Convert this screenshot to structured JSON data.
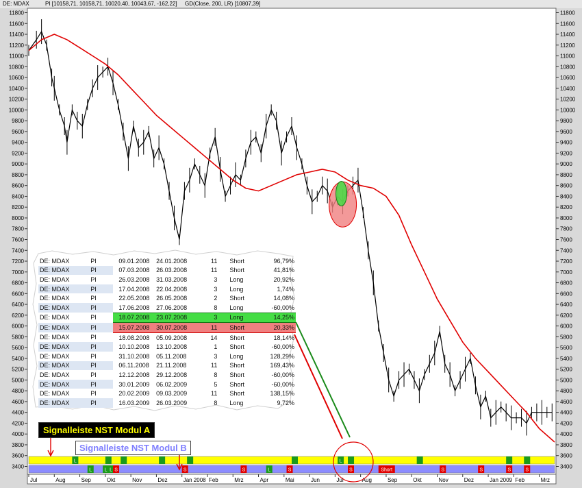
{
  "header": {
    "instrument": "DE: MDAX",
    "legend_pi": "PI [10158,71, 10158,71, 10020,40, 10043,67, -162,22]",
    "legend_gd": "GD(Close, 200, LR) [10807,39]"
  },
  "labels": {
    "signal_a": "Signalleiste NST Modul A",
    "signal_b": "Signalleiste NST Modul B"
  },
  "colors": {
    "price": "#000000",
    "moving_average": "#e00000",
    "strip_a": "#ffff00",
    "strip_b": "#8c8cff",
    "long_marker": "#1a9a1a",
    "short_marker": "#e00000",
    "highlight_long": "#44dd44",
    "highlight_short": "#f08080"
  },
  "trades": [
    {
      "symbol": "DE: MDAX",
      "type": "PI",
      "entry": "09.01.2008",
      "exit": "24.01.2008",
      "days": "11",
      "side": "Short",
      "result": "96,79%"
    },
    {
      "symbol": "DE: MDAX",
      "type": "PI",
      "entry": "07.03.2008",
      "exit": "26.03.2008",
      "days": "11",
      "side": "Short",
      "result": "41,81%"
    },
    {
      "symbol": "DE: MDAX",
      "type": "PI",
      "entry": "26.03.2008",
      "exit": "31.03.2008",
      "days": "3",
      "side": "Long",
      "result": "20,92%"
    },
    {
      "symbol": "DE: MDAX",
      "type": "PI",
      "entry": "17.04.2008",
      "exit": "22.04.2008",
      "days": "3",
      "side": "Long",
      "result": "1,74%"
    },
    {
      "symbol": "DE: MDAX",
      "type": "PI",
      "entry": "22.05.2008",
      "exit": "26.05.2008",
      "days": "2",
      "side": "Short",
      "result": "14,08%"
    },
    {
      "symbol": "DE: MDAX",
      "type": "PI",
      "entry": "17.06.2008",
      "exit": "27.06.2008",
      "days": "8",
      "side": "Long",
      "result": "-60,00%"
    },
    {
      "symbol": "DE: MDAX",
      "type": "PI",
      "entry": "18.07.2008",
      "exit": "23.07.2008",
      "days": "3",
      "side": "Long",
      "result": "14,25%",
      "highlight": "long"
    },
    {
      "symbol": "DE: MDAX",
      "type": "PI",
      "entry": "15.07.2008",
      "exit": "30.07.2008",
      "days": "11",
      "side": "Short",
      "result": "20,33%",
      "highlight": "short"
    },
    {
      "symbol": "DE: MDAX",
      "type": "PI",
      "entry": "18.08.2008",
      "exit": "05.09.2008",
      "days": "14",
      "side": "Short",
      "result": "18,14%"
    },
    {
      "symbol": "DE: MDAX",
      "type": "PI",
      "entry": "10.10.2008",
      "exit": "13.10.2008",
      "days": "1",
      "side": "Short",
      "result": "-60,00%"
    },
    {
      "symbol": "DE: MDAX",
      "type": "PI",
      "entry": "31.10.2008",
      "exit": "05.11.2008",
      "days": "3",
      "side": "Long",
      "result": "128,29%"
    },
    {
      "symbol": "DE: MDAX",
      "type": "PI",
      "entry": "06.11.2008",
      "exit": "21.11.2008",
      "days": "11",
      "side": "Short",
      "result": "169,43%"
    },
    {
      "symbol": "DE: MDAX",
      "type": "PI",
      "entry": "12.12.2008",
      "exit": "29.12.2008",
      "days": "8",
      "side": "Short",
      "result": "-60,00%"
    },
    {
      "symbol": "DE: MDAX",
      "type": "PI",
      "entry": "30.01.2009",
      "exit": "06.02.2009",
      "days": "5",
      "side": "Short",
      "result": "-60,00%"
    },
    {
      "symbol": "DE: MDAX",
      "type": "PI",
      "entry": "20.02.2009",
      "exit": "09.03.2009",
      "days": "11",
      "side": "Short",
      "result": "138,15%"
    },
    {
      "symbol": "DE: MDAX",
      "type": "PI",
      "entry": "16.03.2009",
      "exit": "26.03.2009",
      "days": "8",
      "side": "Long",
      "result": "9,72%"
    }
  ],
  "chart_data": {
    "type": "line",
    "ylim": [
      3300,
      11900
    ],
    "yticks": [
      3400,
      3600,
      3800,
      4000,
      4200,
      4400,
      4600,
      4800,
      5000,
      5200,
      5400,
      5600,
      5800,
      6000,
      6200,
      6400,
      6600,
      6800,
      7000,
      7200,
      7400,
      7600,
      7800,
      8000,
      8200,
      8400,
      8600,
      8800,
      9000,
      9200,
      9400,
      9600,
      9800,
      10000,
      10200,
      10400,
      10600,
      10800,
      11000,
      11200,
      11400,
      11600,
      11800
    ],
    "ytick_labels": [
      "3400",
      "3600",
      "3800",
      "4000",
      "4200",
      "4400",
      "4600",
      "4800",
      "5000",
      "5200",
      "5400",
      "5600",
      "5800",
      "6000",
      "6200",
      "6400",
      "6600",
      "6800",
      "7000",
      "7200",
      "7400",
      "7600",
      "7800",
      "8000",
      "8200",
      "8400",
      "8600",
      "8800",
      "9000",
      "9200",
      "9400",
      "9600",
      "9800",
      "10000",
      "10200",
      "10400",
      "10600",
      "10800",
      "11000",
      "11200",
      "11400",
      "11600",
      "11800"
    ],
    "xlim": [
      0,
      20.6
    ],
    "xticks": [
      0,
      1,
      2,
      3,
      4,
      5,
      6,
      7,
      8,
      9,
      10,
      11,
      12,
      13,
      14,
      15,
      16,
      17,
      18,
      19,
      20
    ],
    "xtick_labels": [
      "Jul",
      "Aug",
      "Sep",
      "Okt",
      "Nov",
      "Dez",
      "Jan 2008",
      "Feb",
      "Mrz",
      "Apr",
      "Mai",
      "Jun",
      "Jul",
      "Aug",
      "Sep",
      "Okt",
      "Nov",
      "Dez",
      "Jan 2009",
      "Feb",
      "Mrz"
    ],
    "x_unit_note": "months from Jul 2007",
    "series": [
      {
        "name": "PI",
        "color": "#000000",
        "x": [
          0,
          0.3,
          0.5,
          0.7,
          0.9,
          1.0,
          1.2,
          1.4,
          1.5,
          1.7,
          1.9,
          2.1,
          2.3,
          2.5,
          2.7,
          2.9,
          3.1,
          3.3,
          3.5,
          3.7,
          3.9,
          4.1,
          4.3,
          4.5,
          4.7,
          4.9,
          5.1,
          5.3,
          5.5,
          5.7,
          5.9,
          6.1,
          6.3,
          6.5,
          6.7,
          6.9,
          7.1,
          7.3,
          7.5,
          7.7,
          7.9,
          8.1,
          8.3,
          8.5,
          8.7,
          8.9,
          9.1,
          9.3,
          9.5,
          9.7,
          9.9,
          10.1,
          10.3,
          10.5,
          10.7,
          10.9,
          11.1,
          11.3,
          11.5,
          11.7,
          11.9,
          12.1,
          12.3,
          12.5,
          12.7,
          12.9,
          13.1,
          13.3,
          13.5,
          13.7,
          13.9,
          14.1,
          14.3,
          14.5,
          14.7,
          14.9,
          15.1,
          15.3,
          15.5,
          15.7,
          15.9,
          16.1,
          16.3,
          16.5,
          16.7,
          16.9,
          17.1,
          17.3,
          17.5,
          17.7,
          17.9,
          18.1,
          18.3,
          18.5,
          18.7,
          18.9,
          19.1,
          19.3,
          19.5,
          19.7,
          19.9,
          20.1,
          20.3,
          20.5
        ],
        "values": [
          11100,
          11300,
          11450,
          11200,
          10600,
          10400,
          10000,
          9700,
          9400,
          10000,
          9800,
          9700,
          10100,
          10400,
          10600,
          10700,
          10800,
          10500,
          10100,
          9600,
          9100,
          9700,
          9300,
          9400,
          9600,
          9100,
          9300,
          9000,
          8500,
          8000,
          7600,
          8500,
          8700,
          9000,
          8800,
          8600,
          9200,
          9500,
          8900,
          8400,
          8600,
          8800,
          8700,
          9100,
          9400,
          9500,
          9200,
          9700,
          10000,
          9800,
          9200,
          9500,
          9700,
          9300,
          9000,
          8600,
          8300,
          8400,
          8600,
          8500,
          8200,
          8400,
          8300,
          8500,
          8600,
          8700,
          8100,
          7400,
          6800,
          6000,
          5500,
          5000,
          4700,
          5000,
          5100,
          5200,
          5000,
          4800,
          5100,
          5300,
          5500,
          5900,
          5300,
          5100,
          4800,
          5000,
          5200,
          5400,
          4900,
          4500,
          4700,
          4300,
          4400,
          4500,
          4400,
          4300,
          4300,
          4300,
          4200,
          4400,
          4400,
          4400,
          4400,
          4400
        ]
      },
      {
        "name": "GD(Close, 200, LR)",
        "color": "#e00000",
        "x": [
          0,
          0.5,
          1,
          1.5,
          2,
          2.5,
          3,
          3.5,
          4,
          4.5,
          5,
          5.5,
          6,
          6.5,
          7,
          7.5,
          8,
          8.5,
          9,
          9.5,
          10,
          10.5,
          11,
          11.5,
          12,
          12.5,
          13,
          13.5,
          14,
          14.5,
          15,
          15.5,
          16,
          16.5,
          17,
          17.5,
          18,
          18.5,
          19,
          19.5,
          20,
          20.6
        ],
        "values": [
          11100,
          11300,
          11400,
          11300,
          11150,
          11000,
          10850,
          10650,
          10400,
          10150,
          9900,
          9700,
          9500,
          9300,
          9100,
          8900,
          8700,
          8550,
          8500,
          8600,
          8700,
          8800,
          8850,
          8900,
          8850,
          8700,
          8600,
          8550,
          8400,
          8050,
          7500,
          7000,
          6500,
          6100,
          5700,
          5400,
          5150,
          4900,
          4650,
          4400,
          4100,
          3850
        ]
      }
    ],
    "signal_strip_a": {
      "markers": [
        {
          "x": 1.7,
          "label": "L",
          "side": "Long"
        },
        {
          "x": 3.0,
          "label": "",
          "side": "Long"
        },
        {
          "x": 3.6,
          "label": "",
          "side": "Long"
        },
        {
          "x": 5.1,
          "label": "",
          "side": "Long"
        },
        {
          "x": 6.2,
          "label": "",
          "side": "Long"
        },
        {
          "x": 10.3,
          "label": "",
          "side": "Long"
        },
        {
          "x": 12.1,
          "label": "L",
          "side": "Long"
        },
        {
          "x": 12.5,
          "label": "",
          "side": "Long"
        },
        {
          "x": 15.2,
          "label": "",
          "side": "Long"
        },
        {
          "x": 18.7,
          "label": "",
          "side": "Long"
        },
        {
          "x": 19.4,
          "label": "",
          "side": "Long"
        }
      ]
    },
    "signal_strip_b": {
      "markers": [
        {
          "x": 2.3,
          "label": "L",
          "side": "Long"
        },
        {
          "x": 2.9,
          "label": "L",
          "side": "Long"
        },
        {
          "x": 3.1,
          "label": "L",
          "side": "Long"
        },
        {
          "x": 3.3,
          "label": "S",
          "side": "Short"
        },
        {
          "x": 6.0,
          "label": "S",
          "side": "Short"
        },
        {
          "x": 8.3,
          "label": "S",
          "side": "Short"
        },
        {
          "x": 9.3,
          "label": "L",
          "side": "Long"
        },
        {
          "x": 10.1,
          "label": "S",
          "side": "Short"
        },
        {
          "x": 12.5,
          "label": "S",
          "side": "Short"
        },
        {
          "x": 13.7,
          "label": "Short",
          "side": "Short"
        },
        {
          "x": 16.1,
          "label": "S",
          "side": "Short"
        },
        {
          "x": 17.6,
          "label": "S",
          "side": "Short"
        },
        {
          "x": 18.7,
          "label": "S",
          "side": "Short"
        },
        {
          "x": 19.4,
          "label": "S",
          "side": "Short"
        }
      ]
    }
  }
}
